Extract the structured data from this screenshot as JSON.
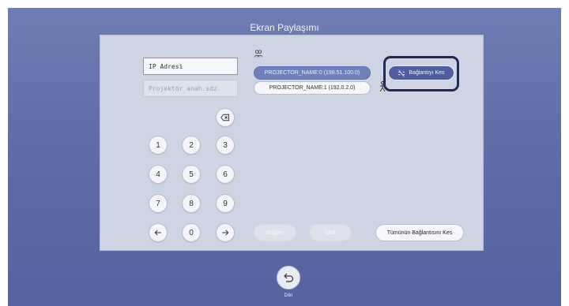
{
  "screen": {
    "title": "Ekran Paylaşımı"
  },
  "form": {
    "ip_value": "IP Adresi",
    "name_placeholder": "Projektör anah.sdz."
  },
  "keypad": {
    "keys": [
      "1",
      "2",
      "3",
      "4",
      "5",
      "6",
      "7",
      "8",
      "9",
      "0"
    ],
    "backspace_icon": "backspace-icon",
    "left_icon": "arrow-left-icon",
    "right_icon": "arrow-right-icon"
  },
  "projectors": {
    "users_icon": "users-icon",
    "items": [
      {
        "label": "PROJECTOR_NAME:0  (198.51.100.0)",
        "selected": true
      },
      {
        "label": "PROJECTOR_NAME:1  (192.0.2.0)",
        "selected": false
      }
    ],
    "disconnect_label": "Bağlantıyı Kes"
  },
  "actions": {
    "connect_label": "Bağlan",
    "cancel_label": "İptal",
    "disconnect_all_label": "Tümünün Bağlantısını Kes"
  },
  "footer": {
    "back_label": "Dön"
  },
  "colors": {
    "background": "#6f7db4",
    "panel": "#cfd4e4",
    "accent": "#4e5e9e",
    "highlight_outline": "#1d2a53"
  }
}
